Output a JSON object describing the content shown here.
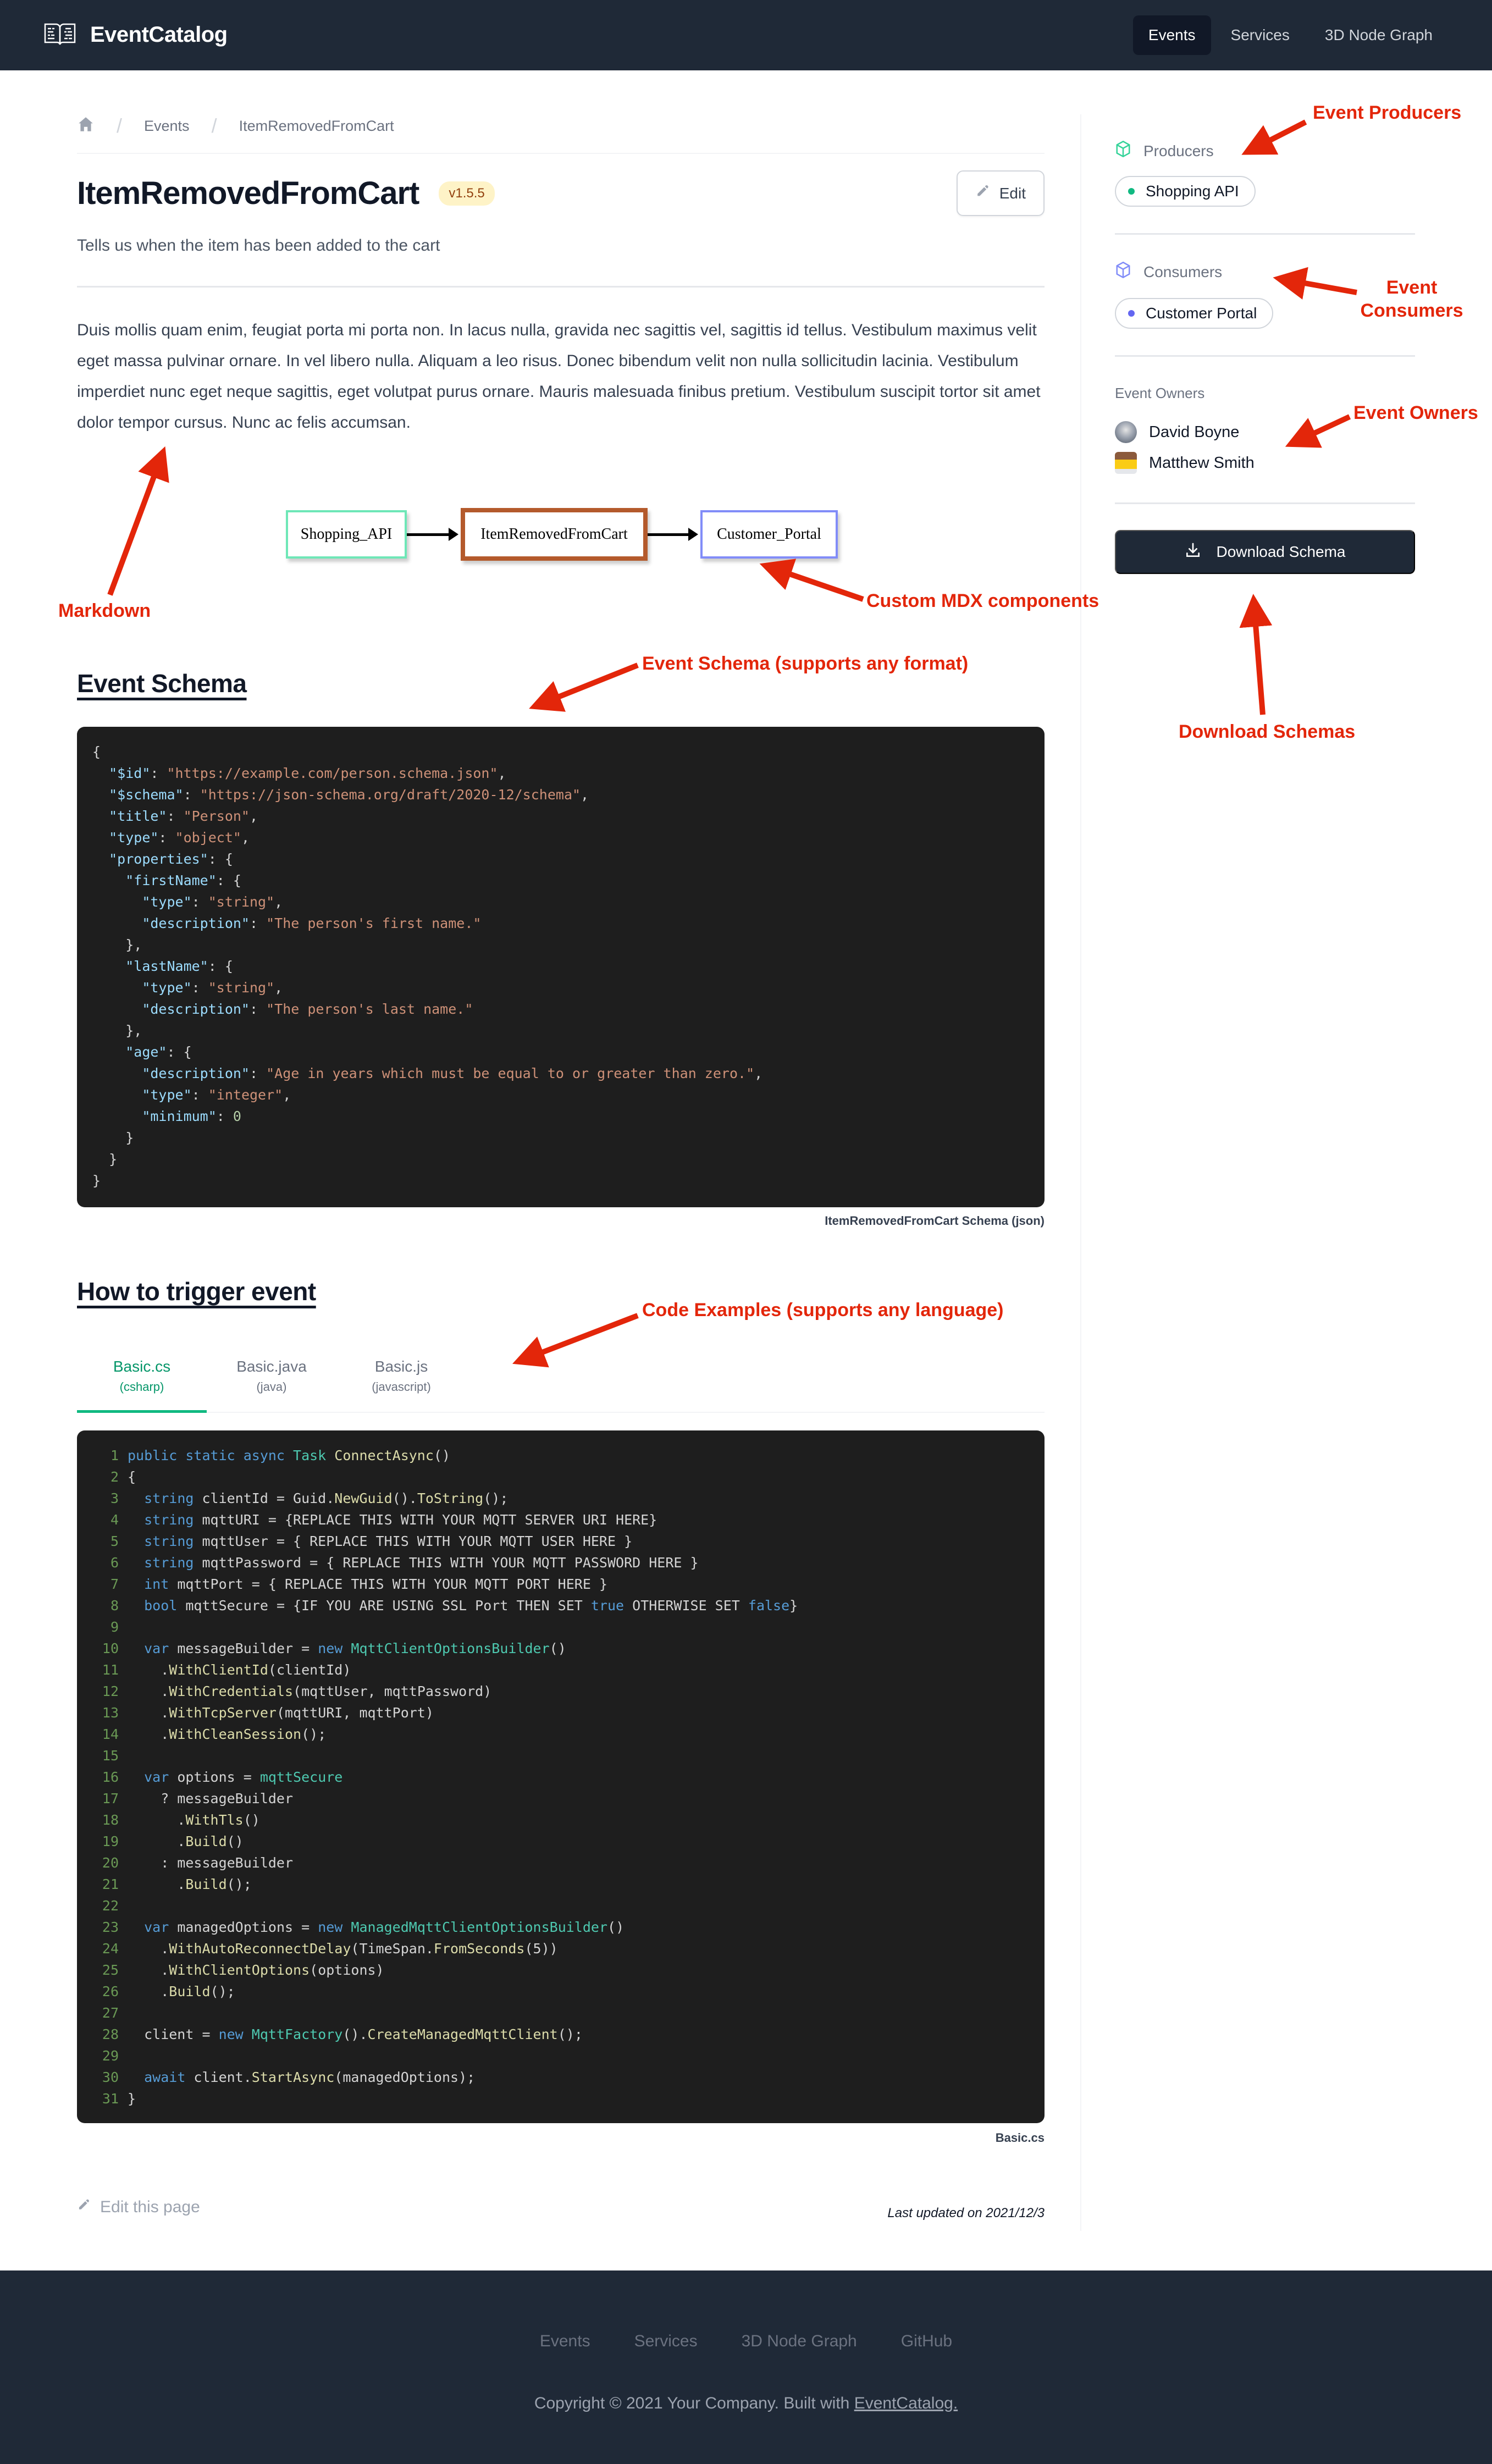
{
  "nav": {
    "brand": "EventCatalog",
    "links": [
      {
        "label": "Events",
        "active": true
      },
      {
        "label": "Services",
        "active": false
      },
      {
        "label": "3D Node Graph",
        "active": false
      }
    ]
  },
  "breadcrumb": {
    "home_icon": "home-icon",
    "items": [
      "Events",
      "ItemRemovedFromCart"
    ]
  },
  "event": {
    "name": "ItemRemovedFromCart",
    "version": "v1.5.5",
    "edit_label": "Edit",
    "summary": "Tells us when the item has been added to the cart",
    "body": "Duis mollis quam enim, feugiat porta mi porta non. In lacus nulla, gravida nec sagittis vel, sagittis id tellus. Vestibulum maximus velit eget massa pulvinar ornare. In vel libero nulla. Aliquam a leo risus. Donec bibendum velit non nulla sollicitudin lacinia. Vestibulum imperdiet nunc eget neque sagittis, eget volutpat purus ornare. Mauris malesuada finibus pretium. Vestibulum suscipit tortor sit amet dolor tempor cursus. Nunc ac felis accumsan."
  },
  "diagram": {
    "nodes": [
      "Shopping_API",
      "ItemRemovedFromCart",
      "Customer_Portal"
    ],
    "colors": {
      "producer": "#6ee7b7",
      "event": "#b45a2c",
      "consumer": "#818cf8"
    }
  },
  "schema": {
    "heading": "Event Schema",
    "caption": "ItemRemovedFromCart Schema (json)",
    "lines": [
      [
        [
          "p",
          "{"
        ]
      ],
      [
        [
          "p",
          "  "
        ],
        [
          "k",
          "\"$id\""
        ],
        [
          "p",
          ": "
        ],
        [
          "s",
          "\"https://example.com/person.schema.json\""
        ],
        [
          "p",
          ","
        ]
      ],
      [
        [
          "p",
          "  "
        ],
        [
          "k",
          "\"$schema\""
        ],
        [
          "p",
          ": "
        ],
        [
          "s",
          "\"https://json-schema.org/draft/2020-12/schema\""
        ],
        [
          "p",
          ","
        ]
      ],
      [
        [
          "p",
          "  "
        ],
        [
          "k",
          "\"title\""
        ],
        [
          "p",
          ": "
        ],
        [
          "s",
          "\"Person\""
        ],
        [
          "p",
          ","
        ]
      ],
      [
        [
          "p",
          "  "
        ],
        [
          "k",
          "\"type\""
        ],
        [
          "p",
          ": "
        ],
        [
          "s",
          "\"object\""
        ],
        [
          "p",
          ","
        ]
      ],
      [
        [
          "p",
          "  "
        ],
        [
          "k",
          "\"properties\""
        ],
        [
          "p",
          ": {"
        ]
      ],
      [
        [
          "p",
          "    "
        ],
        [
          "k",
          "\"firstName\""
        ],
        [
          "p",
          ": {"
        ]
      ],
      [
        [
          "p",
          "      "
        ],
        [
          "k",
          "\"type\""
        ],
        [
          "p",
          ": "
        ],
        [
          "s",
          "\"string\""
        ],
        [
          "p",
          ","
        ]
      ],
      [
        [
          "p",
          "      "
        ],
        [
          "k",
          "\"description\""
        ],
        [
          "p",
          ": "
        ],
        [
          "s",
          "\"The person's first name.\""
        ]
      ],
      [
        [
          "p",
          "    },"
        ]
      ],
      [
        [
          "p",
          "    "
        ],
        [
          "k",
          "\"lastName\""
        ],
        [
          "p",
          ": {"
        ]
      ],
      [
        [
          "p",
          "      "
        ],
        [
          "k",
          "\"type\""
        ],
        [
          "p",
          ": "
        ],
        [
          "s",
          "\"string\""
        ],
        [
          "p",
          ","
        ]
      ],
      [
        [
          "p",
          "      "
        ],
        [
          "k",
          "\"description\""
        ],
        [
          "p",
          ": "
        ],
        [
          "s",
          "\"The person's last name.\""
        ]
      ],
      [
        [
          "p",
          "    },"
        ]
      ],
      [
        [
          "p",
          "    "
        ],
        [
          "k",
          "\"age\""
        ],
        [
          "p",
          ": {"
        ]
      ],
      [
        [
          "p",
          "      "
        ],
        [
          "k",
          "\"description\""
        ],
        [
          "p",
          ": "
        ],
        [
          "s",
          "\"Age in years which must be equal to or greater than zero.\""
        ],
        [
          "p",
          ","
        ]
      ],
      [
        [
          "p",
          "      "
        ],
        [
          "k",
          "\"type\""
        ],
        [
          "p",
          ": "
        ],
        [
          "s",
          "\"integer\""
        ],
        [
          "p",
          ","
        ]
      ],
      [
        [
          "p",
          "      "
        ],
        [
          "k",
          "\"minimum\""
        ],
        [
          "p",
          ": "
        ],
        [
          "n",
          "0"
        ]
      ],
      [
        [
          "p",
          "    }"
        ]
      ],
      [
        [
          "p",
          "  }"
        ]
      ],
      [
        [
          "p",
          "}"
        ]
      ]
    ]
  },
  "trigger": {
    "heading": "How to trigger event",
    "tabs": [
      {
        "file": "Basic.cs",
        "lang": "(csharp)",
        "active": true
      },
      {
        "file": "Basic.java",
        "lang": "(java)",
        "active": false
      },
      {
        "file": "Basic.js",
        "lang": "(javascript)",
        "active": false
      }
    ],
    "caption": "Basic.cs",
    "lines": [
      [
        [
          "w",
          "public static async "
        ],
        [
          "t",
          "Task "
        ],
        [
          "f",
          "ConnectAsync"
        ],
        [
          "p",
          "()"
        ]
      ],
      [
        [
          "p",
          "{"
        ]
      ],
      [
        [
          "p",
          "  "
        ],
        [
          "w",
          "string "
        ],
        [
          "p",
          "clientId = Guid."
        ],
        [
          "f",
          "NewGuid"
        ],
        [
          "p",
          "()."
        ],
        [
          "f",
          "ToString"
        ],
        [
          "p",
          "();"
        ]
      ],
      [
        [
          "p",
          "  "
        ],
        [
          "w",
          "string "
        ],
        [
          "p",
          "mqttURI = {REPLACE THIS WITH YOUR MQTT SERVER URI HERE}"
        ]
      ],
      [
        [
          "p",
          "  "
        ],
        [
          "w",
          "string "
        ],
        [
          "p",
          "mqttUser = { REPLACE THIS WITH YOUR MQTT USER HERE }"
        ]
      ],
      [
        [
          "p",
          "  "
        ],
        [
          "w",
          "string "
        ],
        [
          "p",
          "mqttPassword = { REPLACE THIS WITH YOUR MQTT PASSWORD HERE }"
        ]
      ],
      [
        [
          "p",
          "  "
        ],
        [
          "w",
          "int "
        ],
        [
          "p",
          "mqttPort = { REPLACE THIS WITH YOUR MQTT PORT HERE }"
        ]
      ],
      [
        [
          "p",
          "  "
        ],
        [
          "w",
          "bool "
        ],
        [
          "p",
          "mqttSecure = {IF YOU ARE USING SSL Port THEN SET "
        ],
        [
          "w",
          "true"
        ],
        [
          "p",
          " OTHERWISE SET "
        ],
        [
          "w",
          "false"
        ],
        [
          "p",
          "}"
        ]
      ],
      [
        [
          "p",
          ""
        ]
      ],
      [
        [
          "p",
          "  "
        ],
        [
          "w",
          "var "
        ],
        [
          "p",
          "messageBuilder = "
        ],
        [
          "w",
          "new "
        ],
        [
          "t",
          "MqttClientOptionsBuilder"
        ],
        [
          "p",
          "()"
        ]
      ],
      [
        [
          "p",
          "    ."
        ],
        [
          "f",
          "WithClientId"
        ],
        [
          "p",
          "(clientId)"
        ]
      ],
      [
        [
          "p",
          "    ."
        ],
        [
          "f",
          "WithCredentials"
        ],
        [
          "p",
          "(mqttUser, mqttPassword)"
        ]
      ],
      [
        [
          "p",
          "    ."
        ],
        [
          "f",
          "WithTcpServer"
        ],
        [
          "p",
          "(mqttURI, mqttPort)"
        ]
      ],
      [
        [
          "p",
          "    ."
        ],
        [
          "f",
          "WithCleanSession"
        ],
        [
          "p",
          "();"
        ]
      ],
      [
        [
          "p",
          ""
        ]
      ],
      [
        [
          "p",
          "  "
        ],
        [
          "w",
          "var "
        ],
        [
          "p",
          "options = "
        ],
        [
          "t",
          "mqttSecure"
        ]
      ],
      [
        [
          "p",
          "    ? messageBuilder"
        ]
      ],
      [
        [
          "p",
          "      ."
        ],
        [
          "f",
          "WithTls"
        ],
        [
          "p",
          "()"
        ]
      ],
      [
        [
          "p",
          "      ."
        ],
        [
          "f",
          "Build"
        ],
        [
          "p",
          "()"
        ]
      ],
      [
        [
          "p",
          "    : messageBuilder"
        ]
      ],
      [
        [
          "p",
          "      ."
        ],
        [
          "f",
          "Build"
        ],
        [
          "p",
          "();"
        ]
      ],
      [
        [
          "p",
          ""
        ]
      ],
      [
        [
          "p",
          "  "
        ],
        [
          "w",
          "var "
        ],
        [
          "p",
          "managedOptions = "
        ],
        [
          "w",
          "new "
        ],
        [
          "t",
          "ManagedMqttClientOptionsBuilder"
        ],
        [
          "p",
          "()"
        ]
      ],
      [
        [
          "p",
          "    ."
        ],
        [
          "f",
          "WithAutoReconnectDelay"
        ],
        [
          "p",
          "(TimeSpan."
        ],
        [
          "f",
          "FromSeconds"
        ],
        [
          "p",
          "(5))"
        ]
      ],
      [
        [
          "p",
          "    ."
        ],
        [
          "f",
          "WithClientOptions"
        ],
        [
          "p",
          "(options)"
        ]
      ],
      [
        [
          "p",
          "    ."
        ],
        [
          "f",
          "Build"
        ],
        [
          "p",
          "();"
        ]
      ],
      [
        [
          "p",
          ""
        ]
      ],
      [
        [
          "p",
          "  client = "
        ],
        [
          "w",
          "new "
        ],
        [
          "t",
          "MqttFactory"
        ],
        [
          "p",
          "()."
        ],
        [
          "f",
          "CreateManagedMqttClient"
        ],
        [
          "p",
          "();"
        ]
      ],
      [
        [
          "p",
          ""
        ]
      ],
      [
        [
          "p",
          "  "
        ],
        [
          "w",
          "await "
        ],
        [
          "p",
          "client."
        ],
        [
          "f",
          "StartAsync"
        ],
        [
          "p",
          "(managedOptions);"
        ]
      ],
      [
        [
          "p",
          "}"
        ]
      ]
    ]
  },
  "page_footer": {
    "edit_page": "Edit this page",
    "last_updated": "Last updated on 2021/12/3"
  },
  "sidebar": {
    "producers": {
      "title": "Producers",
      "items": [
        "Shopping API"
      ],
      "color": "#10b981"
    },
    "consumers": {
      "title": "Consumers",
      "items": [
        "Customer Portal"
      ],
      "color": "#6366f1"
    },
    "owners": {
      "title": "Event Owners",
      "items": [
        "David Boyne",
        "Matthew Smith"
      ]
    },
    "download_label": "Download Schema"
  },
  "annotations": {
    "producers": "Event Producers",
    "consumers": "Event Consumers",
    "owners": "Event Owners",
    "markdown": "Markdown",
    "mdx": "Custom MDX components",
    "schema": "Event Schema (supports any format)",
    "download": "Download Schemas",
    "code": "Code Examples (supports any language)"
  },
  "footer": {
    "links": [
      "Events",
      "Services",
      "3D Node Graph",
      "GitHub"
    ],
    "copyright": "Copyright © 2021 Your Company. Built with",
    "copyright_link": "EventCatalog."
  }
}
